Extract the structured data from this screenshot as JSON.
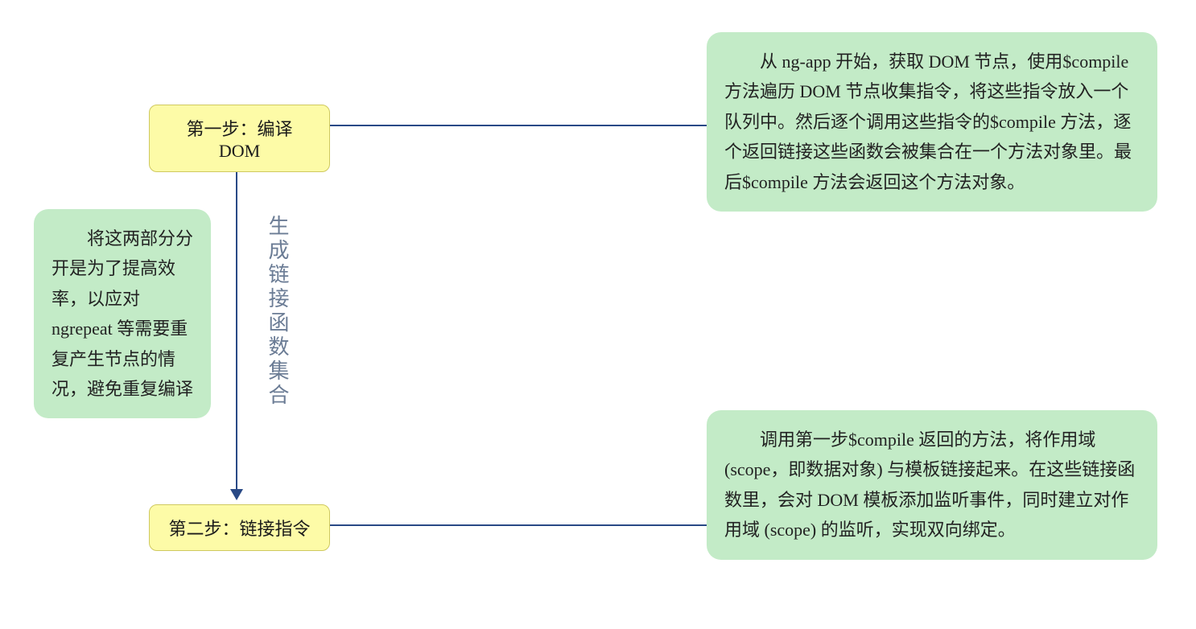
{
  "step1": {
    "label": "第一步：编译 DOM"
  },
  "step2": {
    "label": "第二步：链接指令"
  },
  "arrowLabel": "生成链接函数集合",
  "notes": {
    "left": "将这两部分分开是为了提高效率，以应对ngrepeat 等需要重复产生节点的情况，避免重复编译",
    "rightTop": "从 ng-app 开始，获取 DOM 节点，使用$compile 方法遍历 DOM 节点收集指令，将这些指令放入一个队列中。然后逐个调用这些指令的$compile 方法，逐个返回链接这些函数会被集合在一个方法对象里。最后$compile 方法会返回这个方法对象。",
    "rightBottom": "调用第一步$compile 返回的方法，将作用域 (scope，即数据对象) 与模板链接起来。在这些链接函数里，会对 DOM 模板添加监听事件，同时建立对作用域 (scope) 的监听，实现双向绑定。"
  }
}
